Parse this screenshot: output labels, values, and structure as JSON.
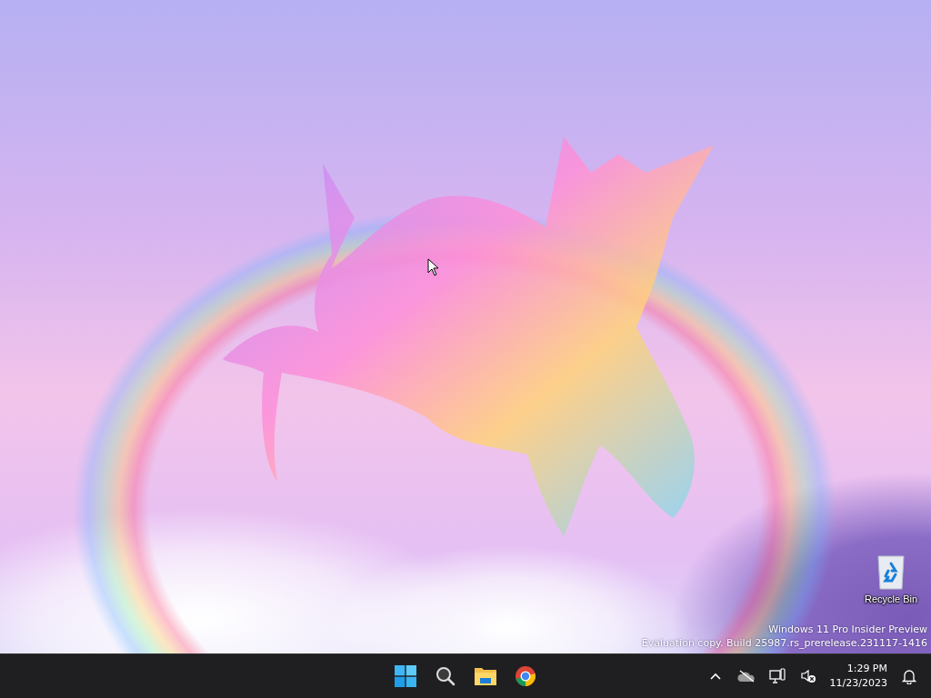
{
  "desktop": {
    "icons": [
      {
        "kind": "recycle-bin",
        "label": "Recycle Bin"
      }
    ],
    "watermark": [
      "Windows 11 Pro Insider Preview",
      "Evaluation copy. Build 25987.rs_prerelease.231117-1416"
    ]
  },
  "taskbar": {
    "apps": [
      {
        "kind": "start"
      },
      {
        "kind": "search"
      },
      {
        "kind": "files"
      },
      {
        "kind": "browser"
      }
    ],
    "tray": {
      "icons": [
        {
          "kind": "chevron"
        },
        {
          "kind": "cloud-off"
        },
        {
          "kind": "network"
        },
        {
          "kind": "sound-muted"
        }
      ],
      "time": "1:29 PM",
      "date": "11/23/2023"
    }
  }
}
